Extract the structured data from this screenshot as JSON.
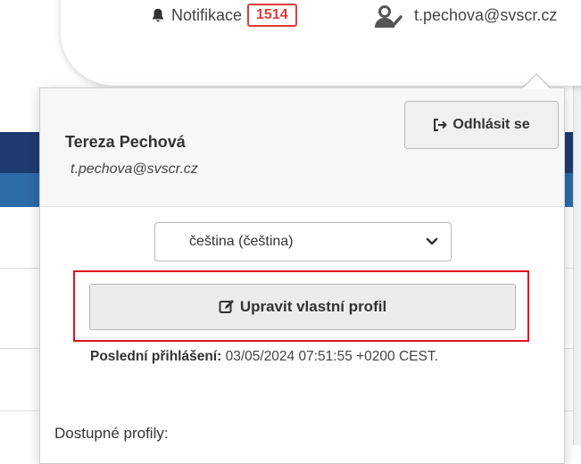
{
  "header": {
    "notifications_label": "Notifikace",
    "notifications_count": "1514",
    "user_email": "t.pechova@svscr.cz"
  },
  "panel": {
    "user_name": "Tereza Pechová",
    "user_email": "t.pechova@svscr.cz",
    "logout_label": "Odhlásit se",
    "language_value": "čeština (čeština)",
    "edit_profile_label": "Upravit vlastní profil",
    "last_login_label": "Poslední přihlášení:",
    "last_login_value": "03/05/2024 07:51:55 +0200 CEST.",
    "available_profiles_label": "Dostupné profily:"
  },
  "colors": {
    "badge": "#e03b3b",
    "highlight": "#e0141e",
    "navy": "#1f3a6e",
    "blue": "#2d6aa8"
  }
}
